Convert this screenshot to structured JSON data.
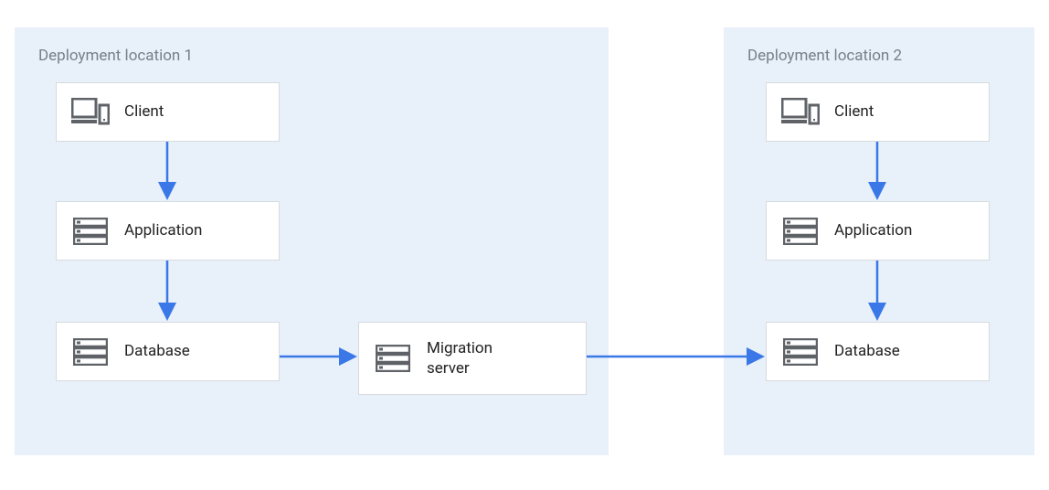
{
  "regions": {
    "loc1": {
      "title": "Deployment location 1"
    },
    "loc2": {
      "title": "Deployment location 2"
    }
  },
  "nodes": {
    "client1": {
      "label": "Client"
    },
    "app1": {
      "label": "Application"
    },
    "db1": {
      "label": "Database"
    },
    "migserver": {
      "label": "Migration\nserver"
    },
    "client2": {
      "label": "Client"
    },
    "app2": {
      "label": "Application"
    },
    "db2": {
      "label": "Database"
    }
  },
  "colors": {
    "arrow": "#3b78e7",
    "region_bg": "#e8f0fa",
    "icon": "#5f6368"
  }
}
